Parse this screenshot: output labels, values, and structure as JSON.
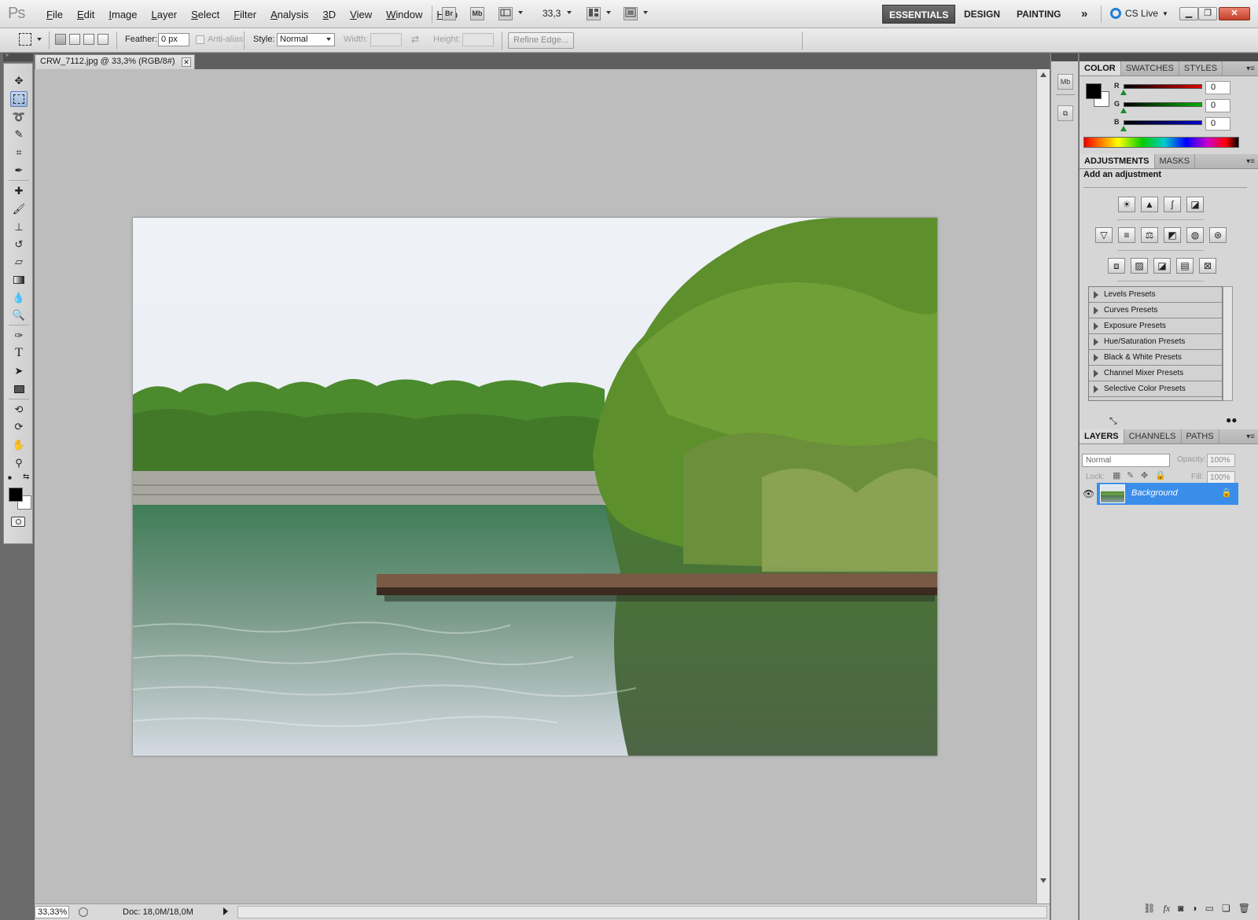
{
  "app": {
    "logo": "Ps",
    "menu": [
      "File",
      "Edit",
      "Image",
      "Layer",
      "Select",
      "Filter",
      "Analysis",
      "3D",
      "View",
      "Window",
      "Help"
    ],
    "bridge_label": "Br",
    "minibridge_label": "Mb",
    "zoom": "33,3",
    "workspaces": {
      "essentials": "ESSENTIALS",
      "design": "DESIGN",
      "painting": "PAINTING",
      "more": "»"
    },
    "cs_live": "CS Live"
  },
  "options": {
    "feather_label": "Feather:",
    "feather_value": "0 px",
    "antialias_label": "Anti-alias",
    "style_label": "Style:",
    "style_value": "Normal",
    "width_label": "Width:",
    "height_label": "Height:",
    "refine_edge": "Refine Edge..."
  },
  "document": {
    "tab_title": "CRW_7112.jpg @ 33,3% (RGB/8#)",
    "close_glyph": "✕"
  },
  "status": {
    "zoom": "33,33%",
    "doc_info": "Doc: 18,0M/18,0M"
  },
  "color_panel": {
    "tabs": [
      "COLOR",
      "SWATCHES",
      "STYLES"
    ],
    "r_label": "R",
    "g_label": "G",
    "b_label": "B",
    "r_value": "0",
    "g_value": "0",
    "b_value": "0",
    "colors": {
      "r": "#dd0000",
      "g": "#00b000",
      "b": "#0000d0"
    }
  },
  "adjustments_panel": {
    "tabs": [
      "ADJUSTMENTS",
      "MASKS"
    ],
    "title": "Add an adjustment",
    "presets": [
      "Levels Presets",
      "Curves Presets",
      "Exposure Presets",
      "Hue/Saturation Presets",
      "Black & White Presets",
      "Channel Mixer Presets",
      "Selective Color Presets"
    ]
  },
  "layers_panel": {
    "tabs": [
      "LAYERS",
      "CHANNELS",
      "PATHS"
    ],
    "blend_mode": "Normal",
    "opacity_label": "Opacity:",
    "opacity_value": "100%",
    "lock_label": "Lock:",
    "fill_label": "Fill:",
    "fill_value": "100%",
    "layers": [
      {
        "name": "Background",
        "selected": true,
        "locked": true
      }
    ]
  },
  "theme": {
    "selection_blue": "#3b8dea",
    "canvas_gray": "#bdbdbd"
  }
}
